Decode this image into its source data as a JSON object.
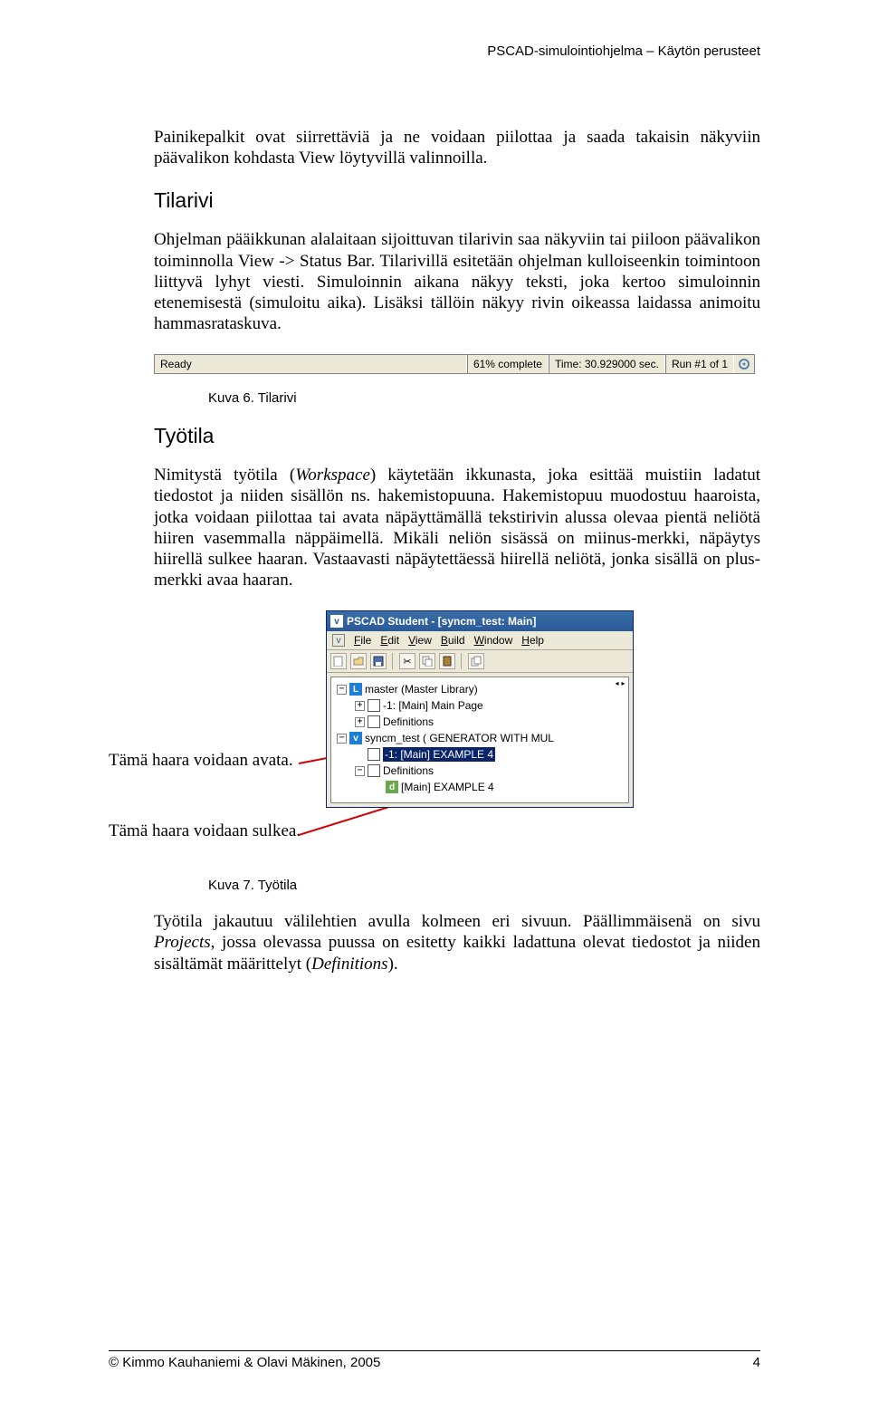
{
  "header": "PSCAD-simulointiohjelma – Käytön perusteet",
  "para1": "Painikepalkit ovat siirrettäviä ja ne voidaan piilottaa ja saada takaisin näkyviin päävalikon kohdasta View löytyvillä valinnoilla.",
  "h_tilarivi": "Tilarivi",
  "para2": "Ohjelman pääikkunan alalaitaan sijoittuvan tilarivin saa näkyviin tai piiloon päävalikon toiminnolla View -> Status Bar. Tilarivillä esitetään ohjelman kulloiseenkin toimintoon liittyvä lyhyt viesti. Simuloinnin aikana näkyy teksti, joka kertoo simuloinnin etenemisestä (simuloitu aika). Lisäksi tällöin näkyy rivin oikeassa laidassa animoitu hammasrataskuva.",
  "statusbar": {
    "ready": "Ready",
    "complete": "61% complete",
    "time": "Time: 30.929000 sec.",
    "run": "Run #1 of 1"
  },
  "caption6": "Kuva 6. Tilarivi",
  "h_tyotila": "Työtila",
  "para3a": "Nimitystä työtila (",
  "para3_ws": "Workspace",
  "para3b": ") käytetään ikkunasta, joka esittää muistiin ladatut tiedostot ja niiden sisällön ns. hakemistopuuna. Hakemistopuu muodostuu haaroista, jotka voidaan piilottaa tai avata näpäyttämällä tekstirivin alussa olevaa pientä neliötä hiiren vasemmalla näppäimellä. Mikäli neliön sisässä on miinus-merkki, näpäytys hiirellä sulkee haaran. Vastaavasti näpäytettäessä hiirellä neliötä, jonka sisällä on plus-merkki avaa haaran.",
  "annot_open": "Tämä haara voidaan avata.",
  "annot_close": "Tämä haara voidaan sulkea.",
  "win": {
    "title": "PSCAD Student - [syncm_test: Main]",
    "menu": [
      "File",
      "Edit",
      "View",
      "Build",
      "Window",
      "Help"
    ],
    "tree": {
      "n1": "master (Master Library)",
      "n2": "-1: [Main] Main Page",
      "n3": "Definitions",
      "n4": "syncm_test ( GENERATOR WITH MUL",
      "n5": "-1: [Main]  EXAMPLE 4",
      "n6": "Definitions",
      "n7": "[Main]  EXAMPLE 4"
    }
  },
  "caption7": "Kuva 7. Työtila",
  "para4a": "Työtila jakautuu välilehtien avulla kolmeen eri sivuun. Päällimmäisenä on sivu ",
  "para4_proj": "Projects",
  "para4b": ", jossa olevassa puussa on esitetty kaikki ladattuna olevat tiedostot ja niiden sisältämät määrittelyt (",
  "para4_def": "Definitions",
  "para4c": ").",
  "footer_left": "© Kimmo Kauhaniemi & Olavi Mäkinen, 2005",
  "footer_right": "4"
}
